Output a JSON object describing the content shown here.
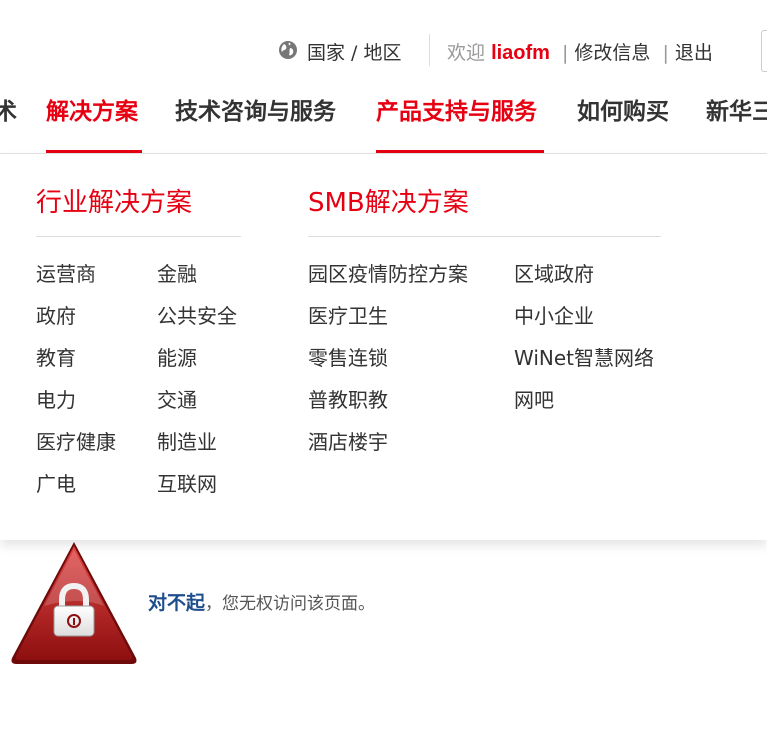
{
  "util_bar": {
    "region": "国家 / 地区",
    "welcome_label": "欢迎",
    "username": "liaofm",
    "separator": "|",
    "edit_profile": "修改信息",
    "logout": "退出"
  },
  "nav": {
    "items": [
      {
        "label": "术",
        "active": false
      },
      {
        "label": "解决方案",
        "active": true
      },
      {
        "label": "技术咨询与服务",
        "active": false
      },
      {
        "label": "产品支持与服务",
        "active": true
      },
      {
        "label": "如何购买",
        "active": false
      },
      {
        "label": "新华三",
        "active": false
      }
    ]
  },
  "dropdown": {
    "industry": {
      "title": "行业解决方案",
      "col1": [
        "运营商",
        "政府",
        "教育",
        "电力",
        "医疗健康",
        "广电"
      ],
      "col2": [
        "金融",
        "公共安全",
        "能源",
        "交通",
        "制造业",
        "互联网"
      ]
    },
    "smb": {
      "title": "SMB解决方案",
      "col1": [
        "园区疫情防控方案",
        "医疗卫生",
        "零售连锁",
        "普教职教",
        "酒店楼宇"
      ],
      "col2": [
        "区域政府",
        "中小企业",
        "WiNet智慧网络",
        "网吧"
      ]
    }
  },
  "denied": {
    "sorry": "对不起",
    "comma": "，",
    "message": "您无权访问该页面。"
  },
  "colors": {
    "brand_red": "#e60012",
    "text_dark": "#333333",
    "text_muted": "#999999",
    "sorry_blue": "#1f4e8c"
  }
}
